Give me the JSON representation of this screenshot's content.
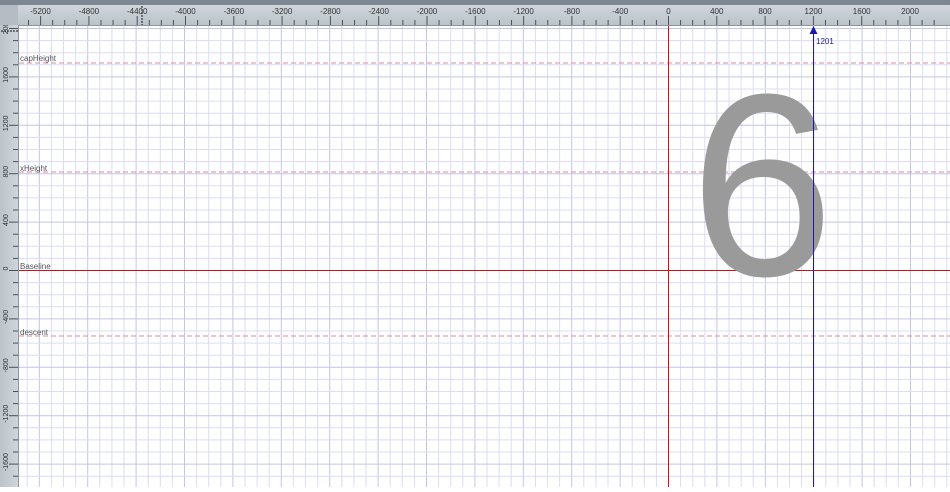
{
  "rulers": {
    "horizontal_ticks": [
      "-5200",
      "-4800",
      "-4400",
      "-4000",
      "-3600",
      "-3200",
      "-2800",
      "-2400",
      "-2000",
      "-1600",
      "-1200",
      "-800",
      "-400",
      "0",
      "400",
      "800",
      "1200",
      "1600",
      "2000"
    ],
    "vertical_ticks": [
      "2000",
      "1600",
      "1200",
      "800",
      "400",
      "0",
      "-400",
      "-800",
      "-1200",
      "-1600"
    ]
  },
  "guides": {
    "capHeight": "capHeight",
    "xHeight": "xHeight",
    "baseline": "Baseline",
    "descent": "descent"
  },
  "advance": {
    "label": "1201"
  },
  "glyph": {
    "character": "6",
    "color": "#9a9a9a"
  },
  "colors": {
    "grid_minor": "#d6d6ee",
    "grid_major": "#bcbce0",
    "origin_line": "#cc1111",
    "advance_line": "#1a1aaa",
    "guide_dashed": "#e08aa0"
  }
}
